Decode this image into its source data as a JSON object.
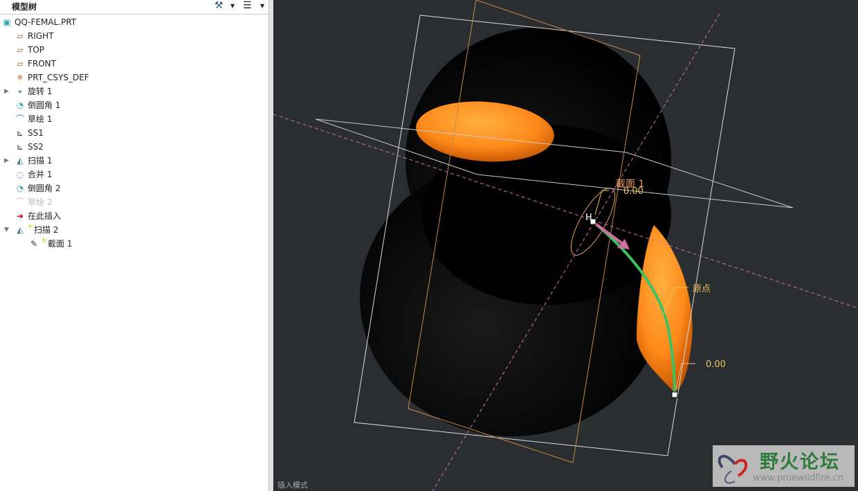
{
  "panel": {
    "title": "模型树"
  },
  "tree": [
    {
      "label": "QQ-FEMAL.PRT",
      "icon": "part-icon",
      "indent": 0
    },
    {
      "label": "RIGHT",
      "icon": "datum-plane-icon",
      "indent": 1
    },
    {
      "label": "TOP",
      "icon": "datum-plane-icon",
      "indent": 1
    },
    {
      "label": "FRONT",
      "icon": "datum-plane-icon",
      "indent": 1
    },
    {
      "label": "PRT_CSYS_DEF",
      "icon": "csys-icon",
      "indent": 1
    },
    {
      "label": "旋转 1",
      "icon": "revolve-icon",
      "indent": 1,
      "expander": "collapsed"
    },
    {
      "label": "倒圆角 1",
      "icon": "round-icon",
      "indent": 1
    },
    {
      "label": "草绘 1",
      "icon": "sketch-icon",
      "indent": 1
    },
    {
      "label": "SS1",
      "icon": "graph-icon",
      "indent": 1
    },
    {
      "label": "SS2",
      "icon": "graph-icon",
      "indent": 1
    },
    {
      "label": "扫描 1",
      "icon": "sweep-icon",
      "indent": 1,
      "expander": "collapsed"
    },
    {
      "label": "合并 1",
      "icon": "merge-icon",
      "indent": 1
    },
    {
      "label": "倒圆角 2",
      "icon": "round-icon",
      "indent": 1
    },
    {
      "label": "草绘 2",
      "icon": "sketch-icon",
      "indent": 1,
      "dimmed": true
    },
    {
      "label": "在此插入",
      "icon": "insert-here-arrow-icon",
      "indent": 1
    },
    {
      "label": "扫描 2",
      "icon": "sweep-icon",
      "indent": 1,
      "expander": "expanded",
      "new": true
    },
    {
      "label": "截面 1",
      "icon": "edit-section-icon",
      "indent": 2,
      "new": true
    }
  ],
  "viewport": {
    "section_label": "截面 1",
    "dim_top": "0.00",
    "origin_label": "原点",
    "dim_bottom": "0.00",
    "h_marker": "H",
    "mode": "插入模式"
  },
  "watermark": {
    "name": "野火论坛",
    "url": "www.proewildfire.cn"
  },
  "colors": {
    "viewport_bg": "#2b2e31",
    "orange": "#ff8a1a",
    "trajectory": "#3cc060",
    "annotation": "#f0c060"
  }
}
